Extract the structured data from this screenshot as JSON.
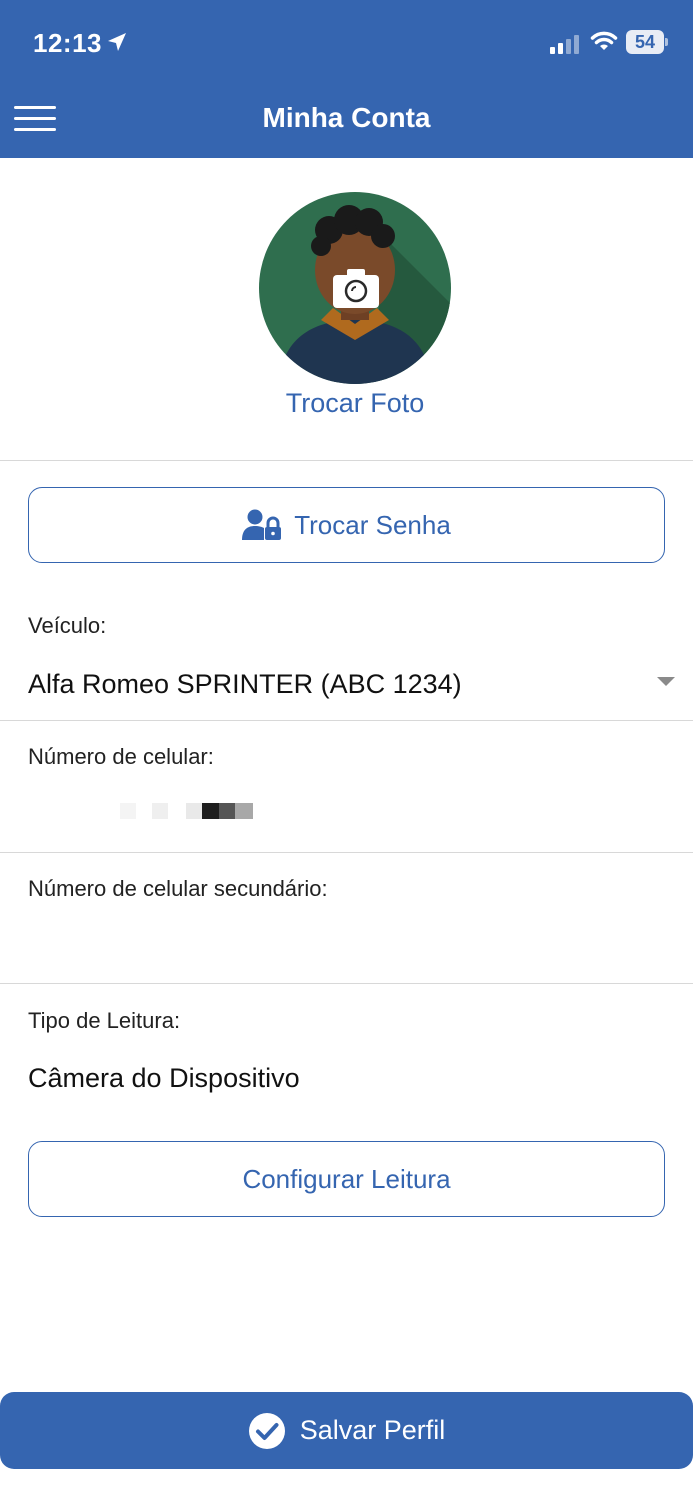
{
  "status_bar": {
    "time": "12:13",
    "battery": "54"
  },
  "header": {
    "title": "Minha Conta"
  },
  "profile": {
    "change_photo_label": "Trocar Foto"
  },
  "buttons": {
    "change_password": "Trocar Senha",
    "configure_reading": "Configurar Leitura",
    "save_profile": "Salvar Perfil"
  },
  "fields": {
    "vehicle_label": "Veículo:",
    "vehicle_value": "Alfa Romeo SPRINTER (ABC 1234)",
    "phone_label": "Número de celular:",
    "secondary_phone_label": "Número de celular secundário:",
    "secondary_phone_value": "",
    "reading_type_label": "Tipo de Leitura:",
    "reading_type_value": "Câmera do Dispositivo"
  },
  "colors": {
    "primary": "#3565b0",
    "avatar_bg": "#2f6e4e"
  },
  "icons": {
    "menu": "hamburger-menu-icon",
    "location": "location-arrow-icon",
    "signal": "cellular-signal-icon",
    "wifi": "wifi-icon",
    "battery": "battery-icon",
    "camera": "camera-icon",
    "user_lock": "user-lock-icon",
    "check": "check-circle-icon",
    "dropdown": "chevron-down-icon"
  }
}
